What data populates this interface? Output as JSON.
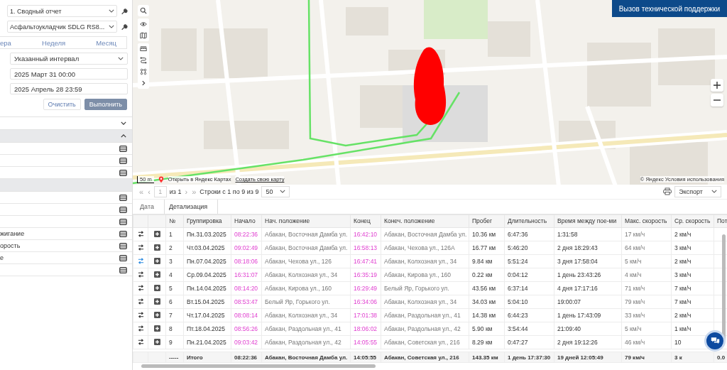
{
  "sidebar": {
    "report_select": "1. Сводный отчет",
    "object_select": "Асфальтоукладчик SDLG RS8...",
    "period_tabs": [
      {
        "label": "ера",
        "selected": false
      },
      {
        "label": "Неделя",
        "selected": false
      },
      {
        "label": "Месяц",
        "selected": false
      }
    ],
    "interval_select": "Указанный интервал",
    "date_from": "2025 Март 31 00:00",
    "date_to": "2025 Апрель 28 23:59",
    "buttons": [
      {
        "label": "Очистить",
        "kind": "secondary"
      },
      {
        "label": "Выполнить",
        "kind": "primary"
      }
    ],
    "sections": [
      {
        "expanded": false
      },
      {
        "expanded": true,
        "items": [
          {
            "kind": "list"
          },
          {
            "kind": "list"
          },
          {
            "kind": "list"
          }
        ]
      },
      {
        "items": [
          {
            "kind": "list"
          },
          {
            "kind": "list"
          },
          {
            "kind": "list"
          },
          {
            "kind": "list",
            "label": "жигание"
          },
          {
            "kind": "list",
            "label": "орость"
          },
          {
            "kind": "list",
            "label": "е"
          },
          {
            "kind": "list"
          }
        ]
      }
    ]
  },
  "map": {
    "support_button": "Вызов технической поддержки",
    "scale": "50 m",
    "open_link": "Открыть в Яндекс Картах",
    "create_link": "Создать свою карту",
    "copyright": "© Яндекс Условия использования"
  },
  "pager": {
    "first": "«",
    "prev": "‹",
    "page": "1",
    "of": "из 1",
    "next": "›",
    "last": "»",
    "rows_info": "Строки с 1 по 9 из 9",
    "page_size": "50",
    "export": "Экспорт"
  },
  "breadcrumbs": [
    "Дата",
    "Детализация"
  ],
  "table": {
    "columns": [
      "№",
      "Группировка",
      "Начало",
      "Нач. положение",
      "Конец",
      "Конеч. положение",
      "Пробег",
      "Длительность",
      "Время между пое-ми",
      "Макс. скорость",
      "Ср. скорость",
      "Пот"
    ],
    "rows": [
      {
        "highlighted": false,
        "cells": [
          "1",
          "Пн.31.03.2025",
          "08:22:36",
          "Абакан, Восточная Дамба ул.",
          "16:42:10",
          "Абакан, Восточная Дамба ул.",
          "10.36 км",
          "6:47:36",
          "1:31:58",
          "17 км/ч",
          "2 км/ч"
        ]
      },
      {
        "highlighted": false,
        "cells": [
          "2",
          "Чт.03.04.2025",
          "09:02:49",
          "Абакан, Восточная Дамба ул.",
          "16:58:13",
          "Абакан, Чехова ул., 126А",
          "16.77 км",
          "5:46:20",
          "2 дня 18:29:43",
          "64 км/ч",
          "3 км/ч"
        ]
      },
      {
        "highlighted": true,
        "cells": [
          "3",
          "Пн.07.04.2025",
          "08:18:06",
          "Абакан, Чехова ул., 126",
          "16:47:41",
          "Абакан, Колхозная ул., 34",
          "9.84 км",
          "5:51:24",
          "3 дня 17:58:04",
          "5 км/ч",
          "2 км/ч"
        ]
      },
      {
        "highlighted": false,
        "cells": [
          "4",
          "Ср.09.04.2025",
          "16:31:07",
          "Абакан, Колхозная ул., 34",
          "16:35:19",
          "Абакан, Кирова ул., 160",
          "0.22 км",
          "0:04:12",
          "1 день 23:43:26",
          "4 км/ч",
          "3 км/ч"
        ]
      },
      {
        "highlighted": false,
        "cells": [
          "5",
          "Пн.14.04.2025",
          "08:14:20",
          "Абакан, Кирова ул., 160",
          "16:29:49",
          "Белый Яр, Горького ул.",
          "43.56 км",
          "6:37:14",
          "4 дня 17:17:16",
          "71 км/ч",
          "7 км/ч"
        ]
      },
      {
        "highlighted": false,
        "cells": [
          "6",
          "Вт.15.04.2025",
          "08:53:47",
          "Белый Яр, Горького ул.",
          "16:34:06",
          "Абакан, Колхозная ул., 34",
          "34.03 км",
          "5:04:10",
          "19:00:07",
          "79 км/ч",
          "7 км/ч"
        ]
      },
      {
        "highlighted": false,
        "cells": [
          "7",
          "Чт.17.04.2025",
          "08:08:14",
          "Абакан, Колхозная ул., 34",
          "17:01:38",
          "Абакан, Раздольная ул., 41",
          "14.38 км",
          "6:44:23",
          "1 день 17:43:09",
          "33 км/ч",
          "2 км/ч"
        ]
      },
      {
        "highlighted": false,
        "cells": [
          "8",
          "Пт.18.04.2025",
          "08:56:26",
          "Абакан, Раздольная ул., 41",
          "18:06:02",
          "Абакан, Раздольная ул., 42",
          "5.90 км",
          "3:54:44",
          "21:09:40",
          "5 км/ч",
          "1 км/ч"
        ]
      },
      {
        "highlighted": false,
        "cells": [
          "9",
          "Пн.21.04.2025",
          "09:03:42",
          "Абакан, Раздольная ул., 42",
          "14:05:55",
          "Абакан, Советская ул., 216",
          "8.29 км",
          "0:47:27",
          "2 дня 19:12:26",
          "46 км/ч",
          "10"
        ]
      }
    ],
    "total": [
      "-----",
      "Итого",
      "08:22:36",
      "Абакан, Восточная Дамба ул.",
      "14:05:55",
      "Абакан, Советская ул., 216",
      "143.35 км",
      "1 день 17:37:30",
      "19 дней 12:05:49",
      "79 км/ч",
      "3 к",
      "0.0"
    ]
  }
}
